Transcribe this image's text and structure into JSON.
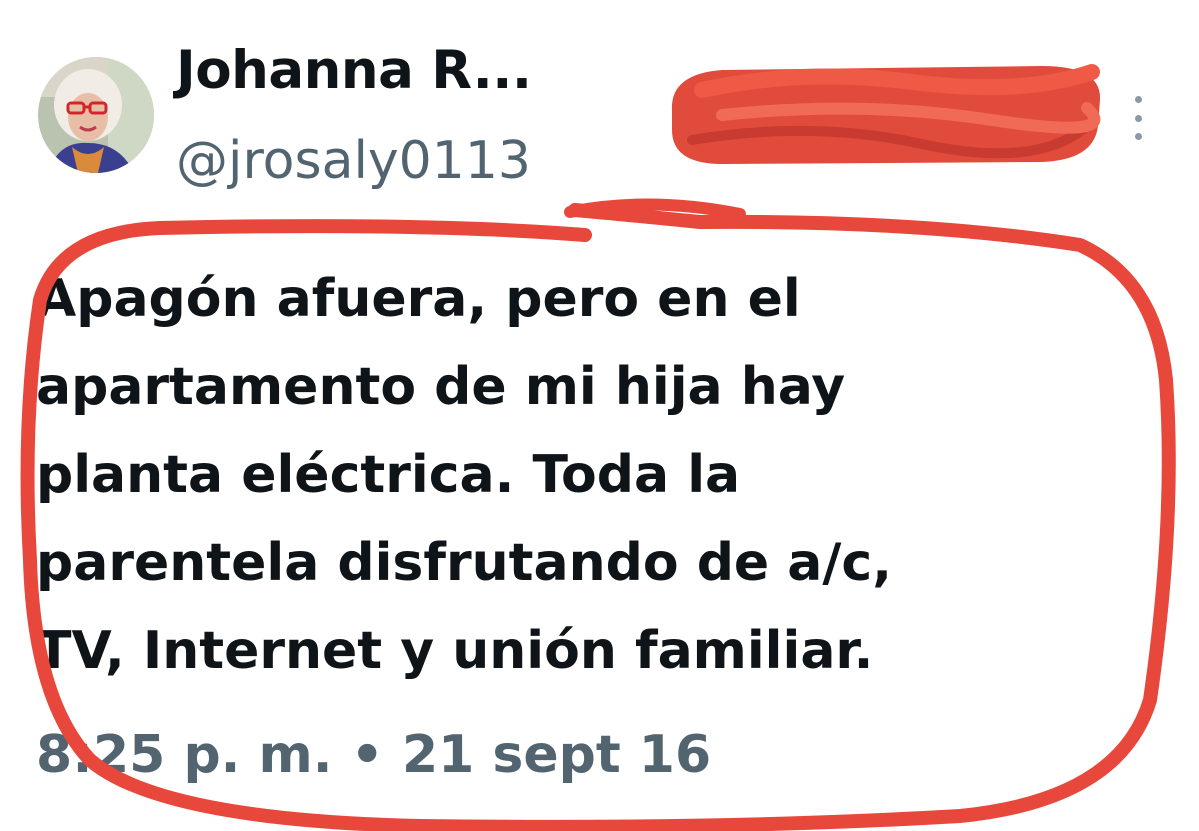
{
  "user": {
    "display_name": "Johanna R...",
    "handle": "@jrosaly0113"
  },
  "tweet": {
    "lines": [
      "Apagón afuera, pero en el",
      "apartamento de mi hija hay",
      "planta eléctrica. Toda la",
      "parentela disfrutando de a/c,",
      "TV, Internet y unión familiar."
    ]
  },
  "meta": {
    "time": "8:25 p. m.",
    "separator": "•",
    "date": "21 sept 16"
  },
  "icons": {
    "avatar": "profile-photo",
    "more": "more-vertical-icon"
  },
  "colors": {
    "annotation_red": "#e8483c",
    "text_primary": "#0f1419",
    "text_secondary": "#536471"
  }
}
